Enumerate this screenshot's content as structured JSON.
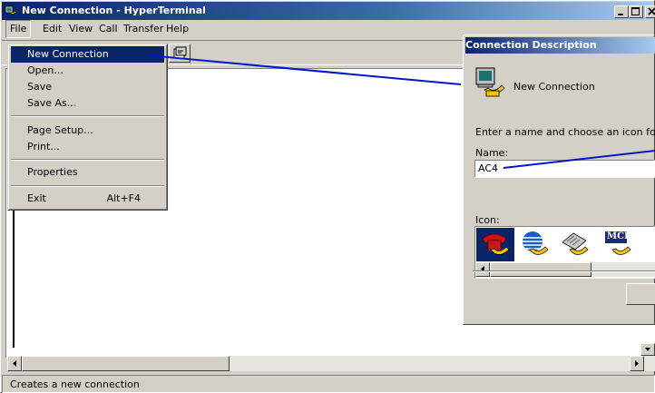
{
  "window": {
    "title": "New Connection - HyperTerminal"
  },
  "menubar": {
    "items": [
      "File",
      "Edit",
      "View",
      "Call",
      "Transfer",
      "Help"
    ]
  },
  "file_menu": {
    "items": [
      {
        "label": "New Connection",
        "selected": true
      },
      {
        "label": "Open..."
      },
      {
        "label": "Save"
      },
      {
        "label": "Save As..."
      },
      {
        "label": "Page Setup..."
      },
      {
        "label": "Print..."
      },
      {
        "label": "Properties"
      },
      {
        "label": "Exit",
        "accelerator": "Alt+F4"
      }
    ]
  },
  "status_bar": {
    "text": "Creates a new connection"
  },
  "dialog": {
    "title": "Connection Description",
    "heading": "New Connection",
    "instructions": "Enter a name and choose an icon for",
    "name_label": "Name:",
    "name_value": "AC4",
    "icon_label": "Icon:",
    "icons": [
      "red-phone-icon",
      "globe-phone-icon",
      "fax-phone-icon",
      "mci-phone-icon"
    ],
    "icon_badge": "MCI"
  },
  "colors": {
    "titlebar": "#0a246a",
    "selection": "#0a246a",
    "callout_line": "#0019c8",
    "chrome": "#d4d0c8"
  }
}
